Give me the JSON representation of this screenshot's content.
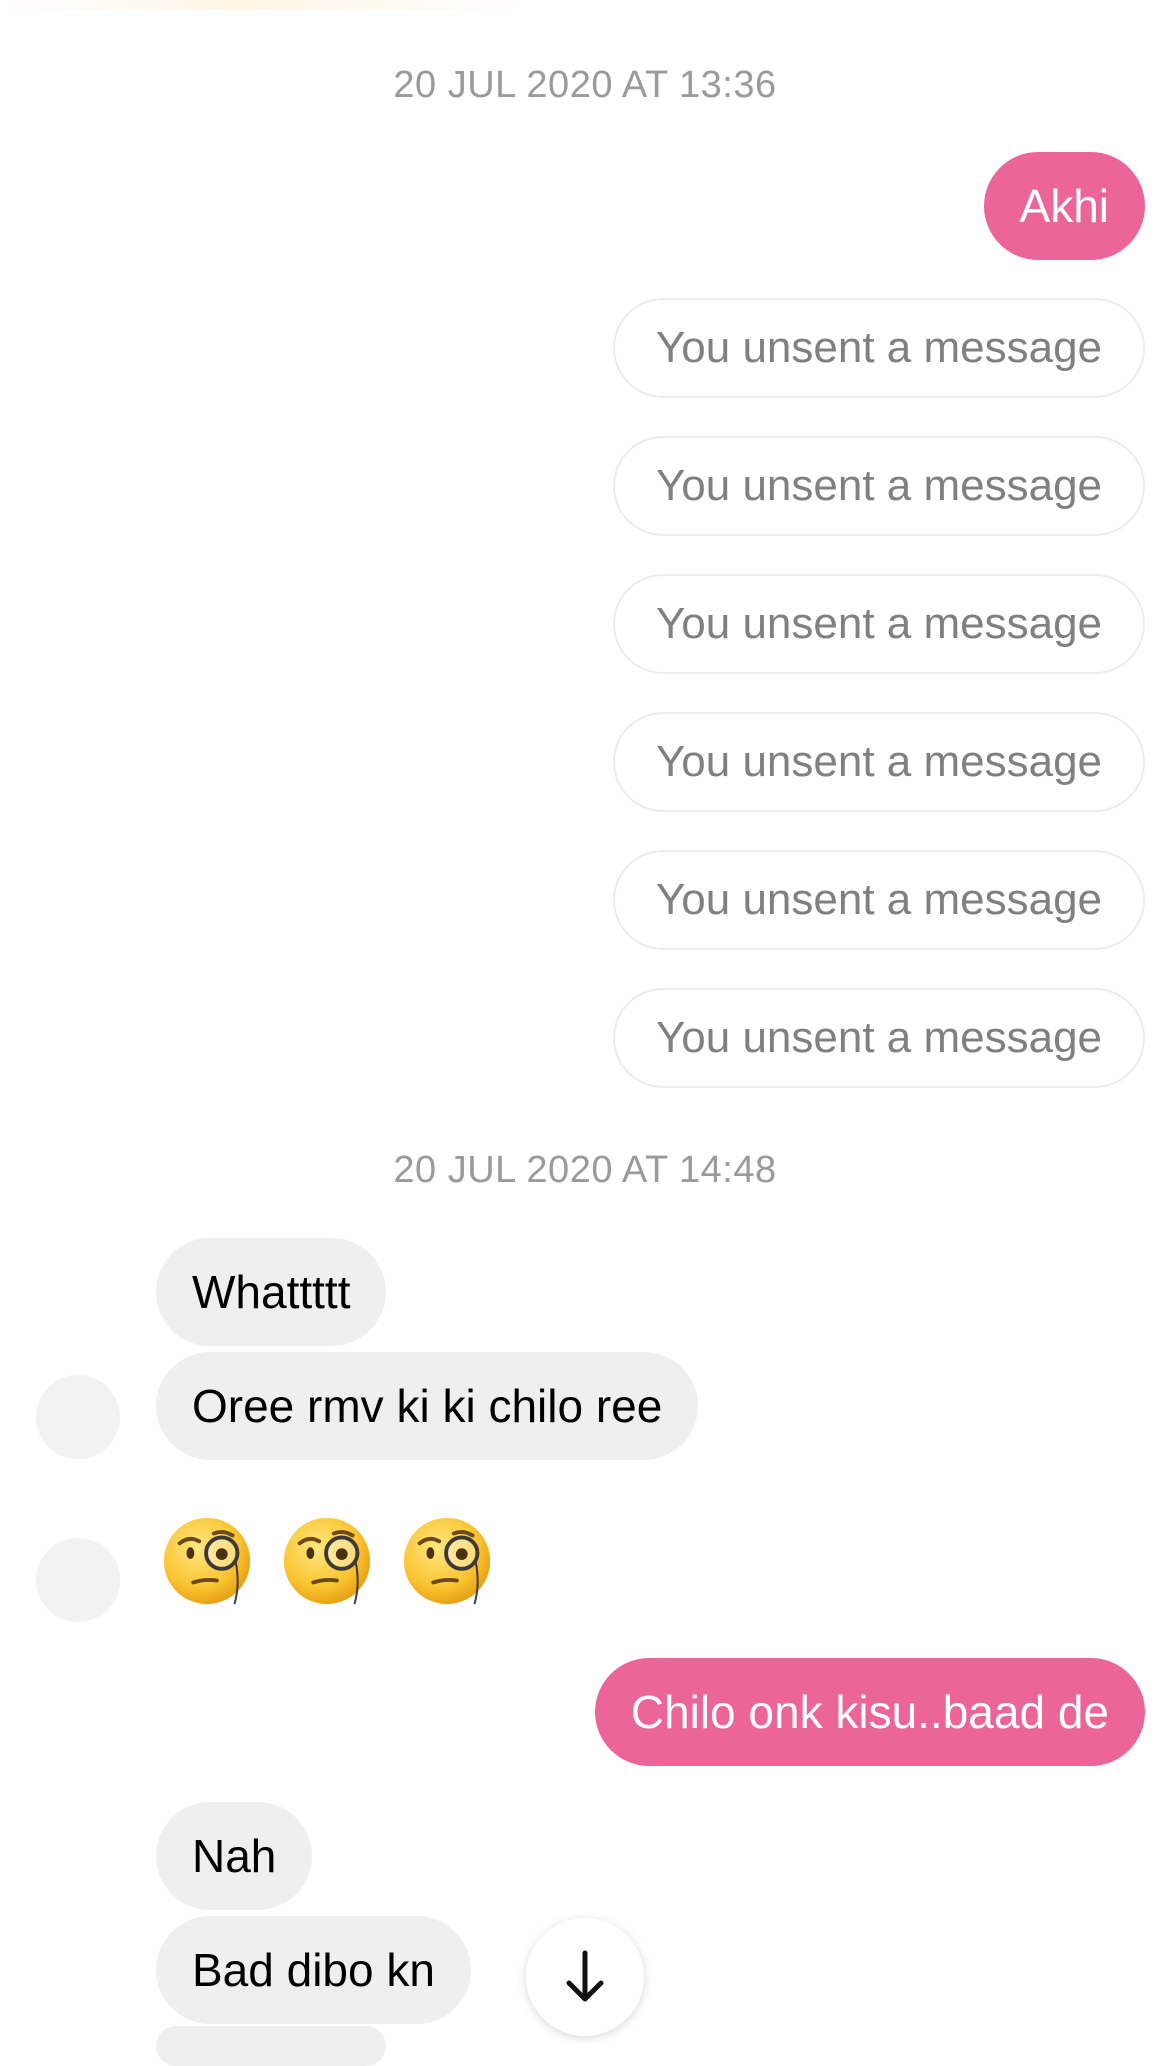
{
  "colors": {
    "sent_bubble": "#ec6599",
    "received_bubble": "#efefef",
    "unsent_text": "#808080",
    "timestamp_text": "#9a9a9a"
  },
  "thread": {
    "timestamp_1": "20 JUL 2020 AT 13:36",
    "sent_1": "Akhi",
    "unsent": [
      "You unsent a message",
      "You unsent a message",
      "You unsent a message",
      "You unsent a message",
      "You unsent a message",
      "You unsent a message"
    ],
    "timestamp_2": "20 JUL 2020 AT 14:48",
    "received_1": "Whattttt",
    "received_2": "Oree rmv ki ki chilo ree",
    "emoji_reply": [
      "face-with-monocle",
      "face-with-monocle",
      "face-with-monocle"
    ],
    "sent_2": "Chilo onk kisu..baad de",
    "received_3": "Nah",
    "received_4": "Bad dibo kn"
  },
  "controls": {
    "scroll_down_icon": "arrow-down-icon"
  }
}
